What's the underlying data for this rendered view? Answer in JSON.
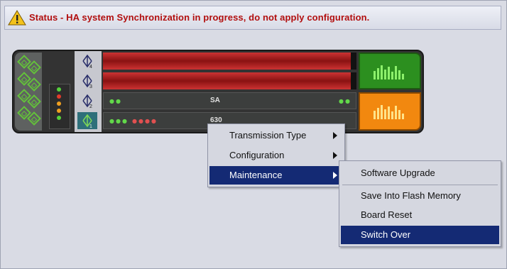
{
  "status": {
    "text": "Status - HA system Synchronization in progress, do not apply configuration.",
    "icon": "warning-icon",
    "text_color": "#b20f0f"
  },
  "chassis": {
    "row3_label": "SA",
    "row4_label": "630",
    "port_labels": [
      "4",
      "3",
      "2",
      "1"
    ],
    "colors": {
      "fault": "#c33333",
      "ok": "#2c8f1f",
      "warn": "#f2880f"
    }
  },
  "context_menu": {
    "items": [
      {
        "label": "Transmission Type",
        "submenu": true
      },
      {
        "label": "Configuration",
        "submenu": true
      },
      {
        "label": "Maintenance",
        "submenu": true,
        "selected": true
      }
    ]
  },
  "submenu": {
    "items": [
      {
        "label": "Software Upgrade"
      },
      {
        "label": "Save Into Flash Memory"
      },
      {
        "label": "Board Reset"
      },
      {
        "label": "Switch Over",
        "selected": true
      }
    ],
    "selection_color": "#142a74"
  }
}
